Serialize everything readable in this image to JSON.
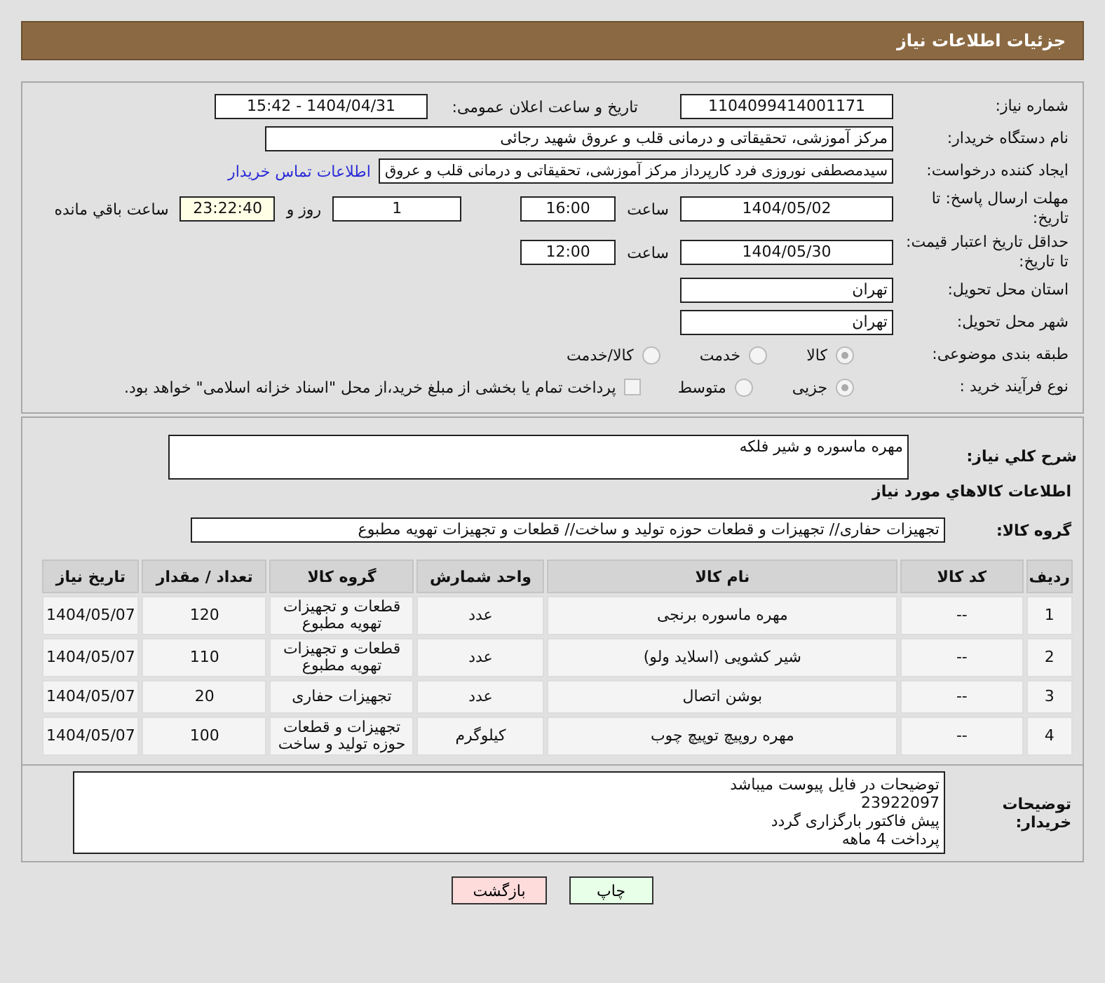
{
  "header": {
    "title": "جزئیات اطلاعات نیاز"
  },
  "need_number": {
    "label": "شماره نیاز:",
    "value": "1104099414001171"
  },
  "announce": {
    "label": "تاریخ و ساعت اعلان عمومی:",
    "value": "1404/04/31 - 15:42"
  },
  "buyer": {
    "label": "نام دستگاه خریدار:",
    "value": "مرکز آموزشی، تحقیقاتی و درمانی قلب و عروق شهید رجائی"
  },
  "creator": {
    "label": "ایجاد کننده درخواست:",
    "value": "سیدمصطفی نوروزی فرد کارپرداز مرکز آموزشی، تحقیقاتی و درمانی قلب و عروق",
    "link": "اطلاعات تماس خریدار"
  },
  "deadline": {
    "label": "مهلت ارسال پاسخ: تا تاریخ:",
    "date": "1404/05/02",
    "time_label": "ساعت",
    "time": "16:00",
    "days": "1",
    "days_label": "روز و",
    "remaining": "23:22:40",
    "remaining_label": "ساعت باقي مانده"
  },
  "validity": {
    "label": "حداقل تاریخ اعتبار قیمت: تا تاریخ:",
    "date": "1404/05/30",
    "time_label": "ساعت",
    "time": "12:00"
  },
  "province": {
    "label": "استان محل تحویل:",
    "value": "تهران"
  },
  "city": {
    "label": "شهر محل تحویل:",
    "value": "تهران"
  },
  "category": {
    "label": "طبقه بندی موضوعی:",
    "options": [
      {
        "label": "کالا",
        "selected": true
      },
      {
        "label": "خدمت",
        "selected": false
      },
      {
        "label": "کالا/خدمت",
        "selected": false
      }
    ]
  },
  "purchase_type": {
    "label": "نوع فرآیند خرید :",
    "options": [
      {
        "label": "جزیی",
        "selected": true
      },
      {
        "label": "متوسط",
        "selected": false
      }
    ],
    "payment": {
      "label": "پرداخت تمام یا بخشی از مبلغ خرید،از محل \"اسناد خزانه اسلامی\" خواهد بود.",
      "checked": false
    }
  },
  "description": {
    "label": "شرح کلي نياز:",
    "value": "مهره ماسوره و شیر فلکه"
  },
  "goods_title": "اطلاعات کالاهاي مورد نياز",
  "goods_group": {
    "label": "گروه کالا:",
    "value": "تجهیزات حفاری// تجهیزات و قطعات حوزه تولید و ساخت//  قطعات و تجهیزات تهویه مطبوع"
  },
  "table": {
    "columns": [
      "ردیف",
      "کد کالا",
      "نام کالا",
      "واحد شمارش",
      "گروه کالا",
      "تعداد / مقدار",
      "تاریخ نیاز"
    ],
    "rows": [
      [
        "1",
        "--",
        "مهره ماسوره برنجی",
        "عدد",
        "قطعات و تجهیزات تهویه مطبوع",
        "120",
        "1404/05/07"
      ],
      [
        "2",
        "--",
        "شیر کشویی (اسلاید ولو)",
        "عدد",
        "قطعات و تجهیزات تهویه مطبوع",
        "110",
        "1404/05/07"
      ],
      [
        "3",
        "--",
        "بوشن اتصال",
        "عدد",
        "تجهیزات حفاری",
        "20",
        "1404/05/07"
      ],
      [
        "4",
        "--",
        "مهره رو‌پیچ توپیچ چوب",
        "کیلوگرم",
        "تجهیزات و قطعات حوزه تولید و ساخت",
        "100",
        "1404/05/07"
      ]
    ]
  },
  "buyer_notes": {
    "label": "توضیحات خریدار:",
    "lines": [
      "توضیحات در فایل پیوست میباشد",
      "23922097",
      "پیش فاکتور بارگزاری گردد",
      "پرداخت 4 ماهه"
    ]
  },
  "buttons": [
    {
      "label": "چاپ",
      "kind": "print"
    },
    {
      "label": "بازگشت",
      "kind": "back"
    }
  ]
}
